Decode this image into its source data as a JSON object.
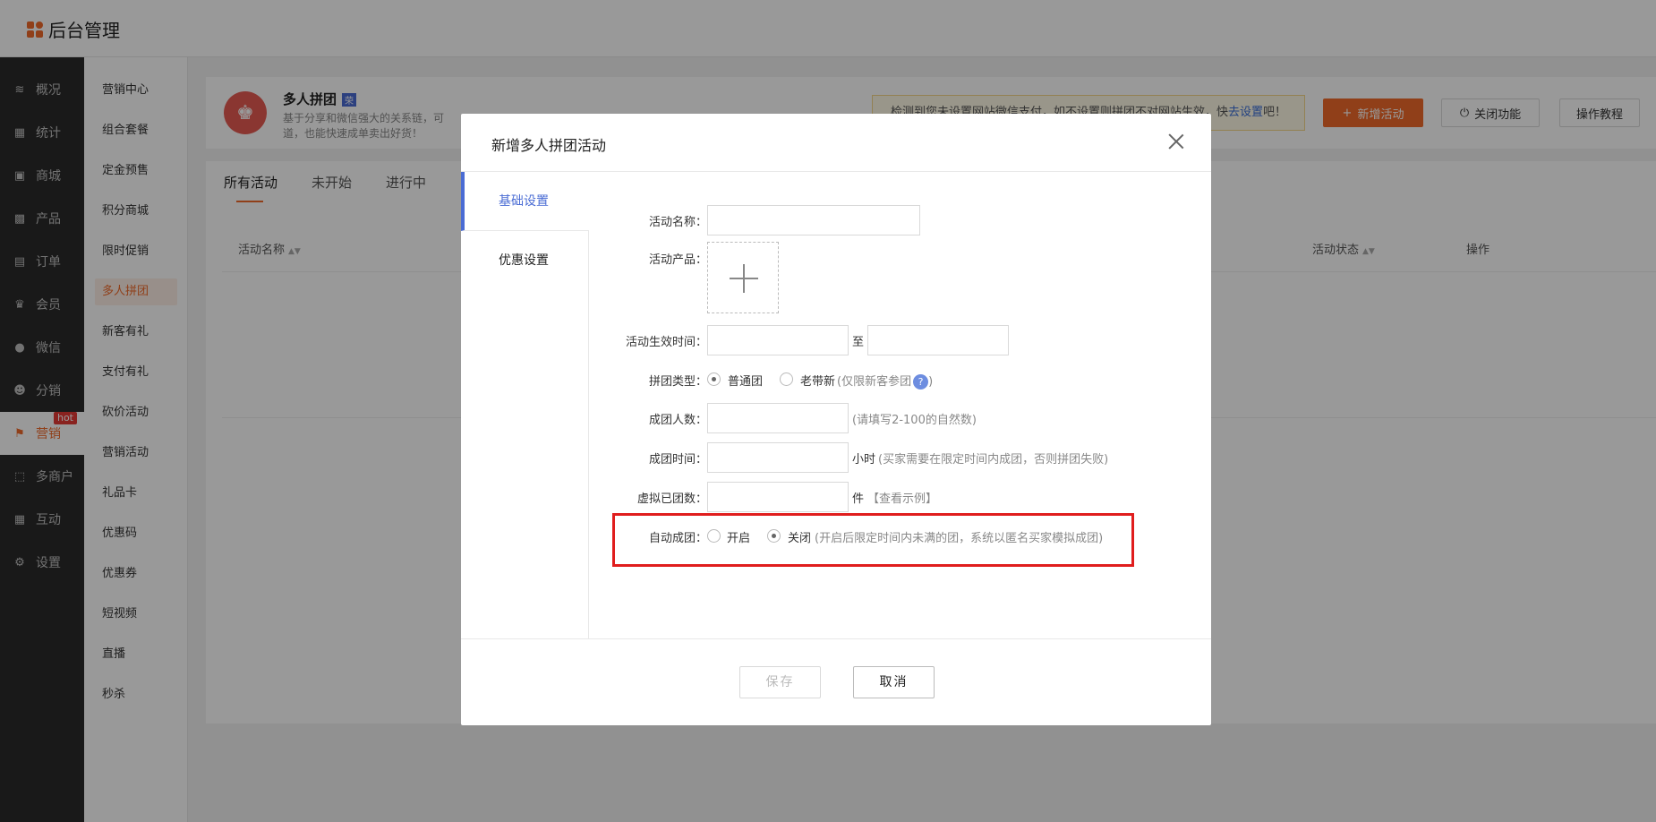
{
  "app": {
    "title": "后台管理"
  },
  "leftnav": {
    "items": [
      {
        "label": "概况",
        "icon": "layers-icon"
      },
      {
        "label": "统计",
        "icon": "chart-icon"
      },
      {
        "label": "商城",
        "icon": "shop-icon"
      },
      {
        "label": "产品",
        "icon": "grid-icon"
      },
      {
        "label": "订单",
        "icon": "order-icon"
      },
      {
        "label": "会员",
        "icon": "crown-icon"
      },
      {
        "label": "微信",
        "icon": "wechat-icon"
      },
      {
        "label": "分销",
        "icon": "user-icon"
      },
      {
        "label": "营销",
        "icon": "flag-icon",
        "badge": "hot"
      },
      {
        "label": "多商户",
        "icon": "store-icon"
      },
      {
        "label": "互动",
        "icon": "apps-icon"
      },
      {
        "label": "设置",
        "icon": "gear-icon"
      }
    ],
    "active": "营销"
  },
  "subnav": {
    "items": [
      "营销中心",
      "组合套餐",
      "定金预售",
      "积分商城",
      "限时促销",
      "多人拼团",
      "新客有礼",
      "支付有礼",
      "砍价活动",
      "营销活动",
      "礼品卡",
      "优惠码",
      "优惠券",
      "短视频",
      "直播",
      "秒杀"
    ],
    "active": "多人拼团"
  },
  "feature": {
    "title": "多人拼团",
    "tag": "荣",
    "desc_line1": "基于分享和微信强大的关系链，可",
    "desc_line2": "道，也能快速成单卖出好货！",
    "notice_text": "检测到您未设置网站微信支付，如不设置则拼团不对网站生效，快",
    "notice_link": "去设置",
    "notice_tail": "吧！",
    "btn_new": "新增活动",
    "btn_close": "关闭功能",
    "btn_tutorial": "操作教程"
  },
  "tabs": [
    "所有活动",
    "未开始",
    "进行中"
  ],
  "table_headers": {
    "name": "活动名称",
    "status": "活动状态",
    "action": "操作"
  },
  "modal": {
    "title": "新增多人拼团活动",
    "side_tabs": [
      "基础设置",
      "优惠设置"
    ],
    "fields": {
      "name_label": "活动名称：",
      "product_label": "活动产品：",
      "time_label": "活动生效时间：",
      "time_to": "至",
      "type_label": "拼团类型：",
      "type_opt1": "普通团",
      "type_opt2": "老带新",
      "type_hint": "(仅限新客参团",
      "type_hint_end": ")",
      "members_label": "成团人数：",
      "members_hint": "(请填写2-100的自然数)",
      "duration_label": "成团时间：",
      "duration_unit": "小时",
      "duration_hint": "(买家需要在限定时间内成团，否则拼团失败)",
      "virtual_label": "虚拟已团数：",
      "virtual_unit": "件",
      "virtual_link": "【查看示例】",
      "auto_label": "自动成团：",
      "auto_on": "开启",
      "auto_off": "关闭",
      "auto_hint": "(开启后限定时间内未满的团，系统以匿名买家模拟成团)"
    },
    "btn_save": "保存",
    "btn_cancel": "取消"
  },
  "colors": {
    "accent": "#f06a2a",
    "blue": "#4a6cd4",
    "highlight": "#e01d1d"
  }
}
